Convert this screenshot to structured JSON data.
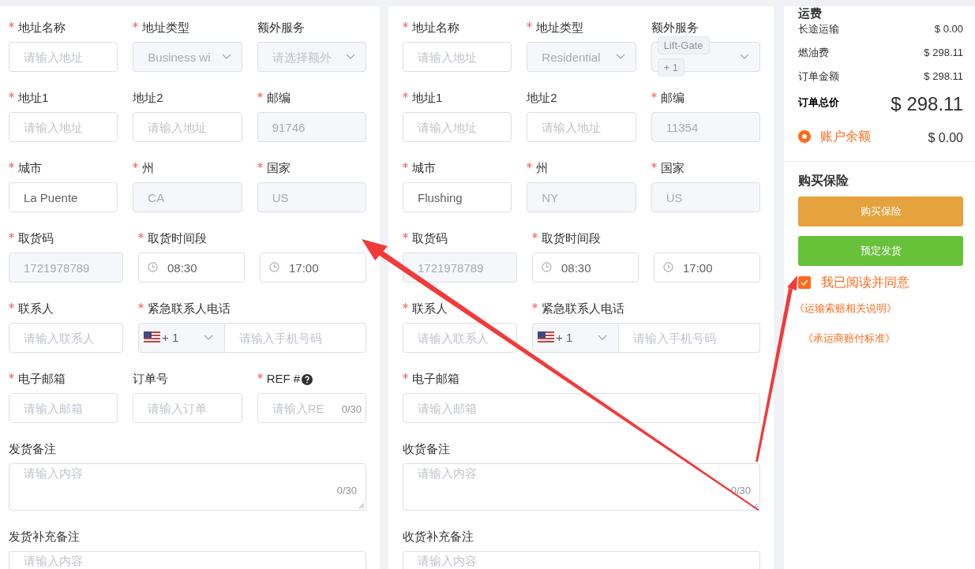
{
  "panels": [
    {
      "rows": [
        [
          {
            "kind": "input",
            "label": "地址名称",
            "required": true,
            "placeholder": "请输入地址"
          },
          {
            "kind": "select",
            "label": "地址类型",
            "required": true,
            "value": "Business wi",
            "disabled": true
          },
          {
            "kind": "select",
            "label": "额外服务",
            "required": false,
            "placeholder": "请选择额外",
            "disabled": true
          }
        ],
        [
          {
            "kind": "input",
            "label": "地址1",
            "required": true,
            "placeholder": "请输入地址"
          },
          {
            "kind": "input",
            "label": "地址2",
            "required": false,
            "placeholder": "请输入地址"
          },
          {
            "kind": "input",
            "label": "邮编",
            "required": true,
            "value": "91746",
            "disabled": true
          }
        ],
        [
          {
            "kind": "input",
            "label": "城市",
            "required": true,
            "value": "La Puente"
          },
          {
            "kind": "input",
            "label": "州",
            "required": true,
            "value": "CA",
            "disabled": true
          },
          {
            "kind": "input",
            "label": "国家",
            "required": true,
            "value": "US",
            "disabled": true
          }
        ],
        [
          {
            "kind": "input",
            "label": "取货码",
            "required": true,
            "value": "1721978789",
            "disabled": true
          },
          {
            "kind": "time",
            "label": "取货时间段",
            "required": true,
            "value": "08:30"
          },
          {
            "kind": "time",
            "value": "17:00"
          }
        ],
        [
          {
            "kind": "input",
            "label": "联系人",
            "required": true,
            "placeholder": "请输入联系人"
          },
          {
            "kind": "phone",
            "label": "紧急联系人电话",
            "required": true,
            "code": "+ 1",
            "placeholder": "请输入手机号码"
          }
        ],
        [
          {
            "kind": "input",
            "label": "电子邮箱",
            "required": true,
            "placeholder": "请输入邮箱"
          },
          {
            "kind": "input",
            "label": "订单号",
            "required": false,
            "placeholder": "请输入订单"
          },
          {
            "kind": "input",
            "label": "REF #",
            "required": true,
            "help": true,
            "placeholder": "请输入RE",
            "counter": "0/30"
          }
        ],
        [
          {
            "kind": "textarea",
            "label": "发货备注",
            "required": false,
            "placeholder": "请输入内容",
            "counter": "0/30"
          }
        ],
        [
          {
            "kind": "textarea",
            "label": "发货补充备注",
            "required": false,
            "placeholder": "请输入内容"
          }
        ]
      ]
    },
    {
      "rows": [
        [
          {
            "kind": "input",
            "label": "地址名称",
            "required": true,
            "placeholder": "请输入地址"
          },
          {
            "kind": "select",
            "label": "地址类型",
            "required": true,
            "value": "Residential",
            "disabled": true
          },
          {
            "kind": "select",
            "label": "额外服务",
            "required": false,
            "disabled": true,
            "tags": [
              "Lift-Gate",
              "+ 1"
            ]
          }
        ],
        [
          {
            "kind": "input",
            "label": "地址1",
            "required": true,
            "placeholder": "请输入地址"
          },
          {
            "kind": "input",
            "label": "地址2",
            "required": false,
            "placeholder": "请输入地址"
          },
          {
            "kind": "input",
            "label": "邮编",
            "required": true,
            "value": "11354",
            "disabled": true
          }
        ],
        [
          {
            "kind": "input",
            "label": "城市",
            "required": true,
            "value": "Flushing"
          },
          {
            "kind": "input",
            "label": "州",
            "required": true,
            "value": "NY",
            "disabled": true
          },
          {
            "kind": "input",
            "label": "国家",
            "required": true,
            "value": "US",
            "disabled": true
          }
        ],
        [
          {
            "kind": "input",
            "label": "取货码",
            "required": true,
            "value": "1721978789",
            "disabled": true
          },
          {
            "kind": "time",
            "label": "取货时间段",
            "required": true,
            "value": "08:30"
          },
          {
            "kind": "time",
            "value": "17:00"
          }
        ],
        [
          {
            "kind": "input",
            "label": "联系人",
            "required": true,
            "placeholder": "请输入联系人"
          },
          {
            "kind": "phone",
            "label": "紧急联系人电话",
            "required": true,
            "code": "+ 1",
            "placeholder": "请输入手机号码"
          }
        ],
        [
          {
            "kind": "input",
            "label": "电子邮箱",
            "required": true,
            "placeholder": "请输入邮箱"
          }
        ],
        [
          {
            "kind": "textarea",
            "label": "收货备注",
            "required": false,
            "placeholder": "请输入内容",
            "counter": "0/30"
          }
        ],
        [
          {
            "kind": "textarea",
            "label": "收货补充备注",
            "required": false,
            "placeholder": "请输入内容"
          }
        ]
      ]
    }
  ],
  "summary": {
    "title": "运费",
    "lines": [
      {
        "label": "长途运输",
        "amount": "$ 0.00"
      },
      {
        "label": "燃油费",
        "amount": "$ 298.11"
      },
      {
        "label": "订单金额",
        "amount": "$ 298.11"
      }
    ],
    "total": {
      "label": "订单总价",
      "amount": "$ 298.11"
    },
    "payment": {
      "label": "账户余额",
      "amount": "$ 0.00",
      "selected": true
    }
  },
  "insurance": {
    "title": "购买保险",
    "buttons": [
      {
        "label": "购买保险",
        "kind": "warning"
      },
      {
        "label": "预定发货",
        "kind": "success"
      }
    ],
    "agreement": {
      "label": "我已阅读并同意",
      "checked": true
    },
    "links": [
      "《运输索赔相关说明》",
      "《承运商赔付标准》"
    ]
  }
}
